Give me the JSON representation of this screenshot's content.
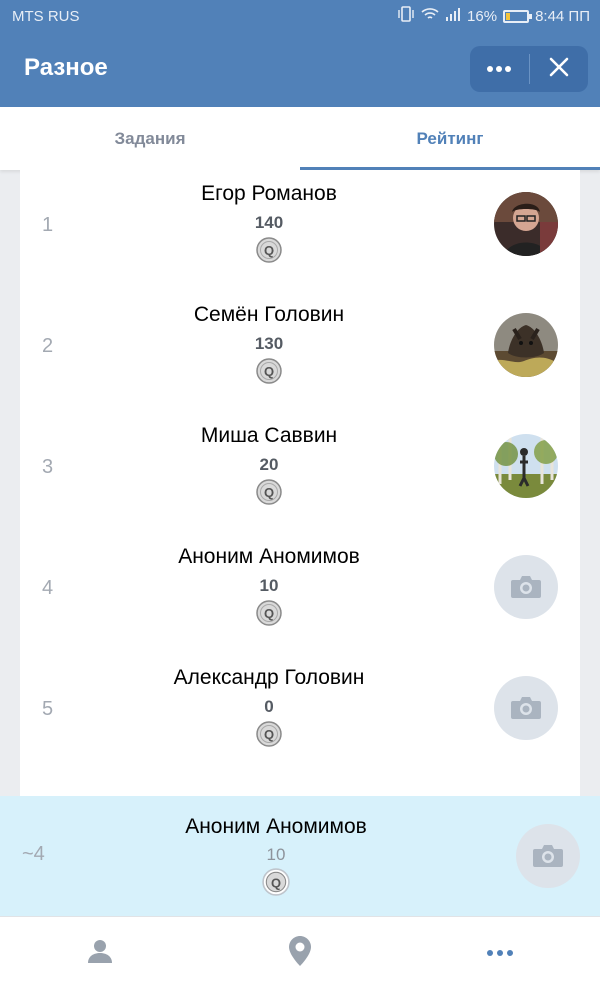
{
  "status_bar": {
    "carrier": "MTS RUS",
    "battery": "16%",
    "battery_level": 0.16,
    "time": "8:44 ПП"
  },
  "header": {
    "title": "Разное",
    "more_icon": "more-dots-icon",
    "close_icon": "close-icon"
  },
  "tabs": [
    {
      "label": "Задания",
      "active": false
    },
    {
      "label": "Рейтинг",
      "active": true
    }
  ],
  "rating": [
    {
      "rank": "1",
      "name": "Егор Романов",
      "score": "140",
      "avatar": "photo"
    },
    {
      "rank": "2",
      "name": "Семён Головин",
      "score": "130",
      "avatar": "photo"
    },
    {
      "rank": "3",
      "name": "Миша Саввин",
      "score": "20",
      "avatar": "photo"
    },
    {
      "rank": "4",
      "name": "Аноним Аномимов",
      "score": "10",
      "avatar": "camera-placeholder"
    },
    {
      "rank": "5",
      "name": "Александр Головин",
      "score": "0",
      "avatar": "camera-placeholder"
    }
  ],
  "current_user": {
    "rank": "~4",
    "name": "Аноним Аномимов",
    "score": "10",
    "avatar": "camera-placeholder"
  },
  "bottom_nav": [
    {
      "icon": "person-icon",
      "active": false
    },
    {
      "icon": "location-pin-icon",
      "active": false
    },
    {
      "icon": "more-dots-icon",
      "active": true
    }
  ],
  "colors": {
    "accent": "#5181b8",
    "highlight_row": "#d7f1fb",
    "muted_text": "#828a99"
  }
}
